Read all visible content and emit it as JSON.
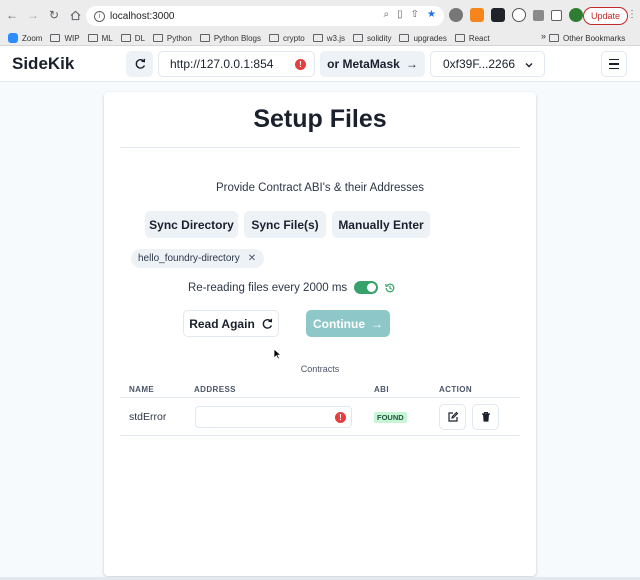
{
  "browser": {
    "url": "localhost:3000",
    "update_label": "Update",
    "bookmarks": [
      "Zoom",
      "WIP",
      "ML",
      "DL",
      "Python",
      "Python Blogs",
      "crypto",
      "w3.js",
      "solidity",
      "upgrades",
      "React"
    ],
    "more_bookmarks": "»",
    "other_bookmarks": "Other Bookmarks"
  },
  "navbar": {
    "brand": "SideKik",
    "rpc_url": "http://127.0.0.1:854",
    "metamask_label": "or MetaMask",
    "account": "0xf39F...2266"
  },
  "card": {
    "title": "Setup Files",
    "subtitle": "Provide Contract ABI's & their Addresses",
    "buttons": {
      "sync_directory": "Sync Directory",
      "sync_files": "Sync File(s)",
      "manually_enter": "Manually Enter"
    },
    "tag": "hello_foundry-directory",
    "reread_text": "Re-reading files every 2000 ms",
    "reread_enabled": true,
    "read_again": "Read Again",
    "continue": "Continue",
    "contracts_caption": "Contracts",
    "table": {
      "headers": [
        "NAME",
        "ADDRESS",
        "ABI",
        "ACTION"
      ],
      "rows": [
        {
          "name": "stdError",
          "address": "",
          "abi_status": "FOUND"
        }
      ]
    }
  },
  "colors": {
    "toggle_on": "#38a169",
    "continue_disabled": "#8dc7c7",
    "error": "#e53e3e",
    "found_bg": "#c6f6d5"
  }
}
